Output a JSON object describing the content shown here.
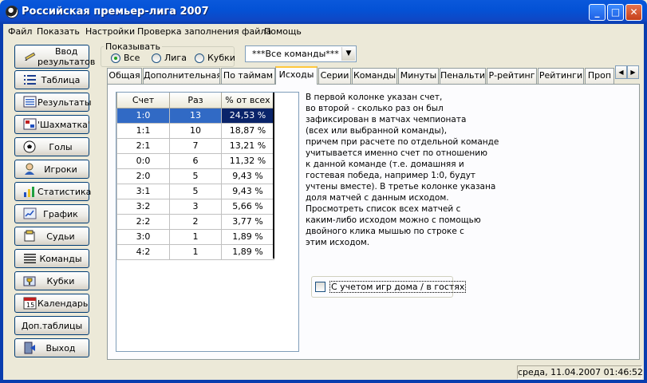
{
  "window": {
    "title": "Российская премьер-лига 2007",
    "controls": {
      "minimize": "_",
      "maximize": "□",
      "close": "✕"
    }
  },
  "menu": [
    "Файл",
    "Показать",
    "Настройки",
    "Проверка заполнения файла",
    "Помощь"
  ],
  "nav": [
    {
      "label_line1": "Ввод",
      "label_line2": "результатов",
      "icon": "pencil-icon"
    },
    {
      "label": "Таблица",
      "icon": "list-icon"
    },
    {
      "label": "Результаты",
      "icon": "results-icon"
    },
    {
      "label": "'Шахматка'",
      "icon": "chessboard-icon"
    },
    {
      "label": "Голы",
      "icon": "ball-icon"
    },
    {
      "label": "Игроки",
      "icon": "player-icon"
    },
    {
      "label": "Статистика",
      "icon": "stats-icon"
    },
    {
      "label": "График",
      "icon": "chart-icon"
    },
    {
      "label": "Судьи",
      "icon": "referee-icon"
    },
    {
      "label": "Команды",
      "icon": "teams-icon"
    },
    {
      "label": "Кубки",
      "icon": "cup-icon"
    },
    {
      "label": "Календарь",
      "icon": "calendar-icon"
    },
    {
      "label": "Доп.таблицы",
      "icon": ""
    },
    {
      "label": "Выход",
      "icon": "exit-icon"
    }
  ],
  "show_filter": {
    "legend": "Показывать",
    "options": [
      "Все",
      "Лига",
      "Кубки"
    ],
    "selected": "Все"
  },
  "team_select": {
    "value": "***Все команды***"
  },
  "tabs": [
    "Общая",
    "Дополнительная",
    "По таймам",
    "Исходы",
    "Серии",
    "Команды",
    "Минуты",
    "Пенальти",
    "Р-рейтинг",
    "Рейтинги",
    "Проп"
  ],
  "active_tab": "Исходы",
  "grid": {
    "headers": [
      "Счет",
      "Раз",
      "% от всех"
    ],
    "rows": [
      [
        "1:0",
        "13",
        "24,53 %"
      ],
      [
        "1:1",
        "10",
        "18,87 %"
      ],
      [
        "2:1",
        "7",
        "13,21 %"
      ],
      [
        "0:0",
        "6",
        "11,32 %"
      ],
      [
        "2:0",
        "5",
        "9,43 %"
      ],
      [
        "3:1",
        "5",
        "9,43 %"
      ],
      [
        "3:2",
        "3",
        "5,66 %"
      ],
      [
        "2:2",
        "2",
        "3,77 %"
      ],
      [
        "3:0",
        "1",
        "1,89 %"
      ],
      [
        "4:2",
        "1",
        "1,89 %"
      ]
    ],
    "selected_row": 0
  },
  "description_lines": [
    "В первой колонке указан счет,",
    "во второй - сколько раз он был",
    "зафиксирован в матчах чемпионата",
    "(всех или выбранной команды),",
    "причем при расчете по отдельной команде",
    "учитывается именно счет по отношению",
    "к данной команде (т.е. домашняя и",
    "гостевая победа, например 1:0, будут",
    "учтены вместе). В третье колонке указана",
    "доля матчей с данным исходом.",
    "Просмотреть список всех матчей с",
    "каким-либо исходом можно с помощью",
    "двойного клика мышью по строке с",
    "этим исходом."
  ],
  "home_away_checkbox": {
    "label": "С учетом игр дома / в гостях",
    "checked": false
  },
  "status": {
    "datetime": "среда, 11.04.2007 01:46:52"
  },
  "colors": {
    "title_bar": "#0A58DB",
    "selection": "#316AC5",
    "window_bg": "#ECE9D8"
  }
}
